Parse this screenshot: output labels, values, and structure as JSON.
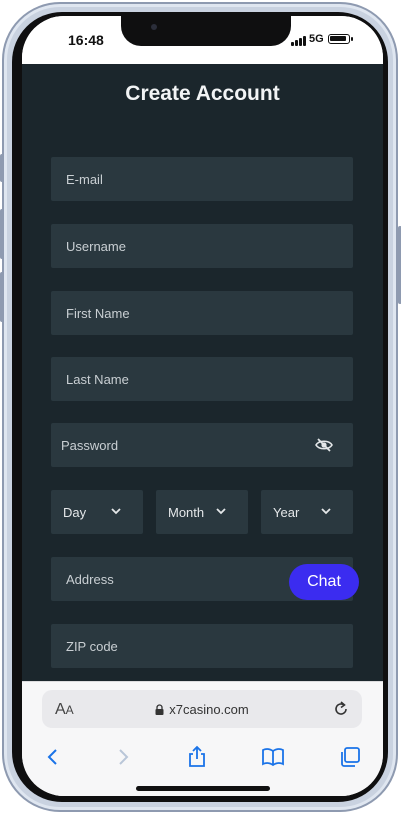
{
  "status": {
    "time": "16:48",
    "network": "5G"
  },
  "page": {
    "title": "Create Account",
    "fields": {
      "email": "E-mail",
      "username": "Username",
      "first_name": "First Name",
      "last_name": "Last Name",
      "password": "Password",
      "address": "Address",
      "zip": "ZIP code"
    },
    "dob": {
      "day": "Day",
      "month": "Month",
      "year": "Year"
    },
    "chat_label": "Chat"
  },
  "browser": {
    "aa_big": "A",
    "aa_small": "A",
    "url": "x7casino.com"
  },
  "colors": {
    "page_bg": "#1b262c",
    "field_bg": "#2a383f",
    "chat": "#3b2cf0",
    "ios_blue": "#1a73e8"
  }
}
